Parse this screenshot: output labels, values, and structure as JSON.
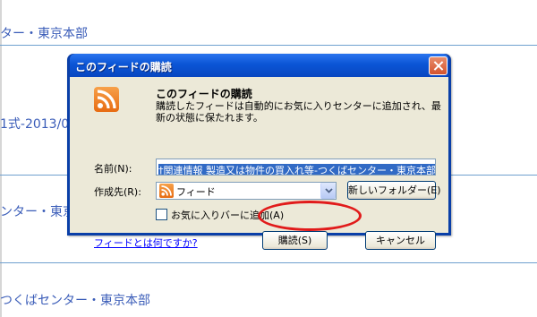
{
  "background": {
    "links": [
      "ター・東京本部",
      "1式-2013/0",
      "ンター・東京本",
      "つくばセンター・東京本部"
    ]
  },
  "dialog": {
    "title": "このフィードの購読",
    "heading": "このフィードの購読",
    "description": "購読したフィードは自動的にお気に入りセンターに追加され、最新の状態に保たれます。",
    "name_label": "名前(N):",
    "name_value": "†関連情報 製造又は物件の買入れ等-つくばセンター・東京本部",
    "create_in_label": "作成先(R):",
    "create_in_value": "フィード",
    "new_folder_button": "新しいフォルダー(E)",
    "favorites_bar_checkbox": "お気に入りバーに追加(A)",
    "favorites_bar_checked": false,
    "help_link": "フィードとは何ですか?",
    "subscribe_button": "購読(S)",
    "cancel_button": "キャンセル"
  },
  "colors": {
    "titlebar": "#0b55d6",
    "dialog_face": "#ece9d8",
    "rss_orange": "#e76b12",
    "link_blue": "#3a5cb8",
    "highlight_red": "#e11b1b"
  },
  "icons": [
    "rss-feed-icon",
    "close-icon",
    "chevron-down-icon"
  ]
}
